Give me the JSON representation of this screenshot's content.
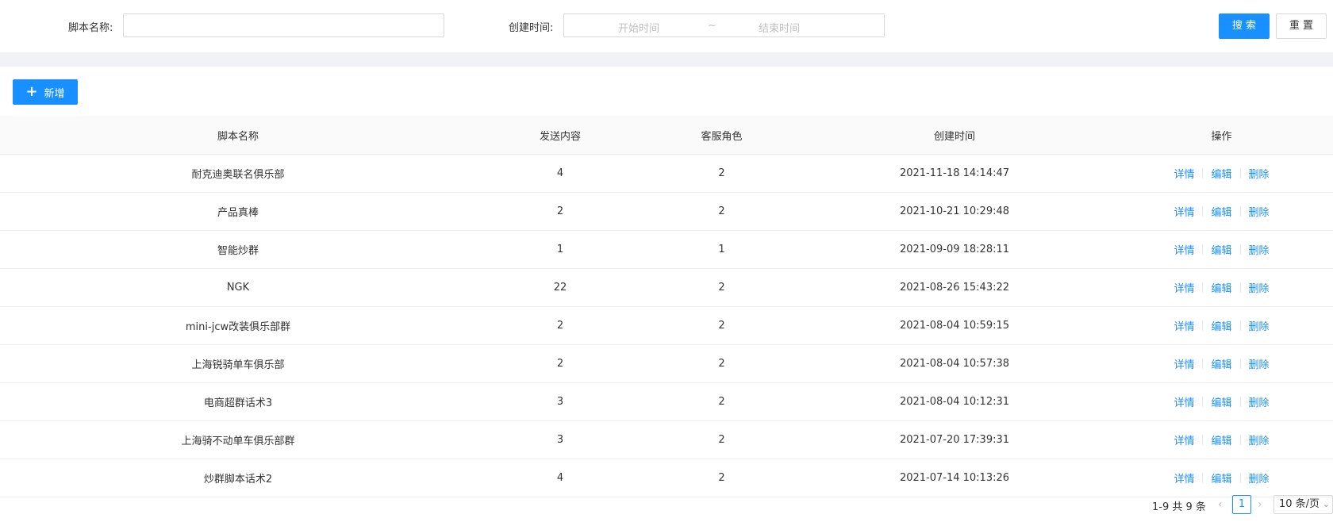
{
  "filters": {
    "script_name_label": "脚本名称:",
    "script_name_value": "",
    "created_label": "创建时间:",
    "start_placeholder": "开始时间",
    "range_separator": "~",
    "end_placeholder": "结束时间",
    "search_label": "搜 索",
    "reset_label": "重 置"
  },
  "toolbar": {
    "add_icon": "plus-icon",
    "add_label": "新增"
  },
  "table": {
    "columns": [
      "脚本名称",
      "发送内容",
      "客服角色",
      "创建时间",
      "操作"
    ],
    "rows": [
      {
        "name": "耐克迪奥联名俱乐部",
        "content": "4",
        "role": "2",
        "created": "2021-11-18 14:14:47"
      },
      {
        "name": "产品真棒",
        "content": "2",
        "role": "2",
        "created": "2021-10-21 10:29:48"
      },
      {
        "name": "智能炒群",
        "content": "1",
        "role": "1",
        "created": "2021-09-09 18:28:11"
      },
      {
        "name": "NGK",
        "content": "22",
        "role": "2",
        "created": "2021-08-26 15:43:22"
      },
      {
        "name": "mini-jcw改装俱乐部群",
        "content": "2",
        "role": "2",
        "created": "2021-08-04 10:59:15"
      },
      {
        "name": "上海锐骑单车俱乐部",
        "content": "2",
        "role": "2",
        "created": "2021-08-04 10:57:38"
      },
      {
        "name": "电商超群话术3",
        "content": "3",
        "role": "2",
        "created": "2021-08-04 10:12:31"
      },
      {
        "name": "上海骑不动单车俱乐部群",
        "content": "3",
        "role": "2",
        "created": "2021-07-20 17:39:31"
      },
      {
        "name": "炒群脚本话术2",
        "content": "4",
        "role": "2",
        "created": "2021-07-14 10:13:26"
      }
    ],
    "actions": {
      "detail": "详情",
      "edit": "编辑",
      "delete": "删除"
    }
  },
  "pagination": {
    "total_text": "1-9 共 9 条",
    "current_page": "1",
    "page_size": "10 条/页"
  },
  "colors": {
    "primary": "#1890ff",
    "band": "#f0f2f5"
  }
}
